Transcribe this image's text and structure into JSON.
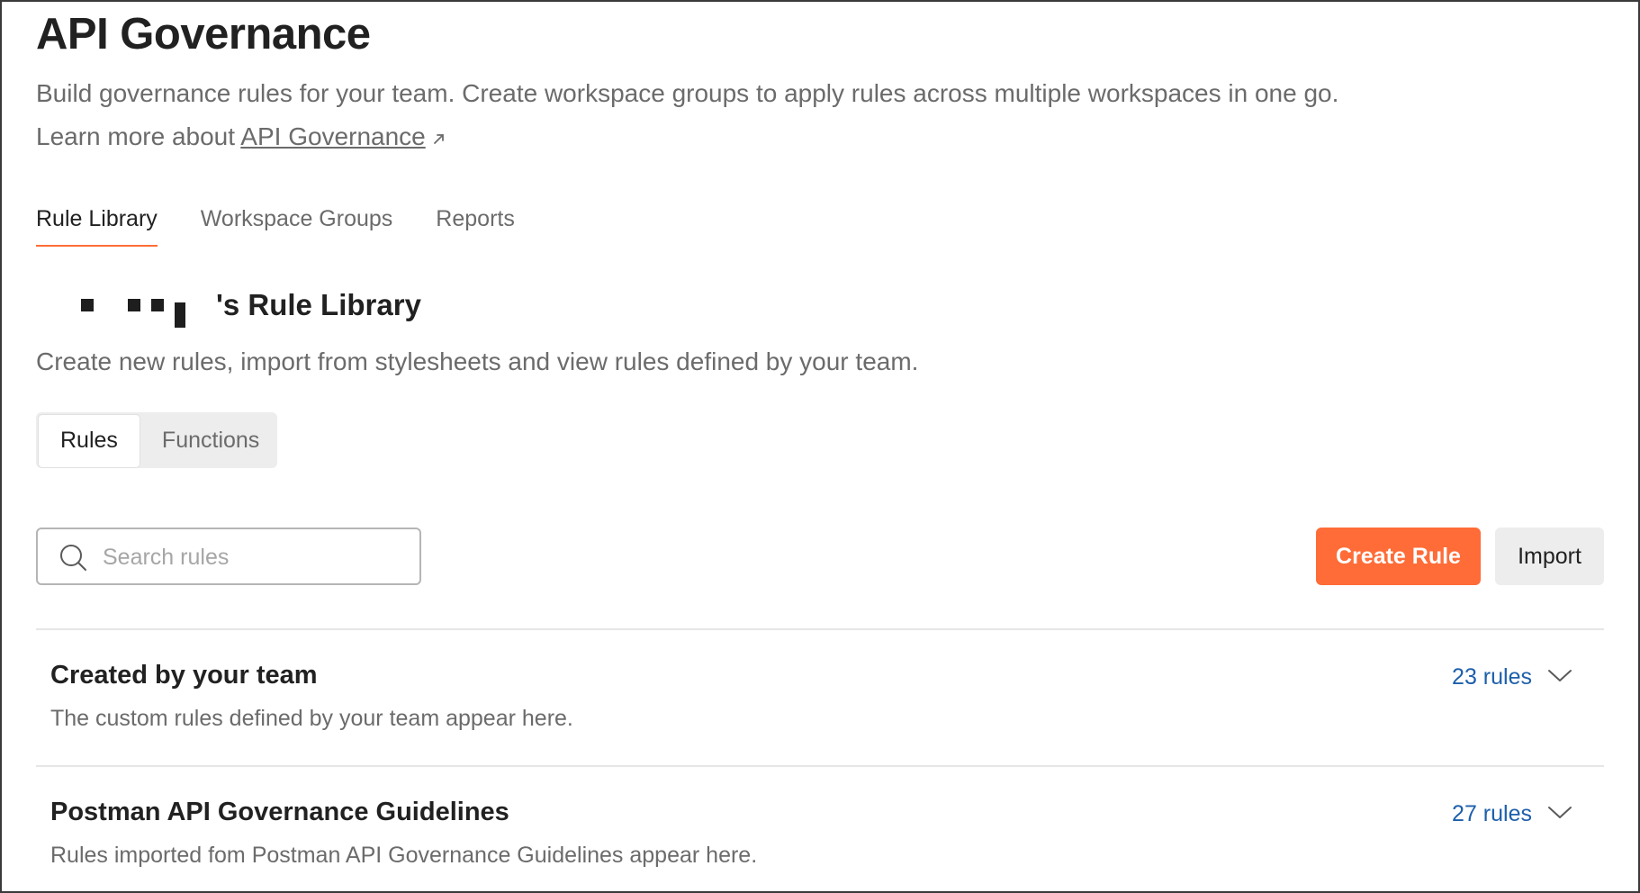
{
  "page": {
    "title": "API Governance",
    "description": "Build governance rules for your team. Create workspace groups to apply rules across multiple workspaces in one go.",
    "learn_more_prefix": "Learn more about ",
    "learn_more_link": "API Governance"
  },
  "tabs": [
    {
      "label": "Rule Library",
      "active": true
    },
    {
      "label": "Workspace Groups",
      "active": false
    },
    {
      "label": "Reports",
      "active": false
    }
  ],
  "library": {
    "title_suffix": "'s Rule Library",
    "description": "Create new rules, import from stylesheets and view rules defined by your team."
  },
  "segmented": {
    "items": [
      {
        "label": "Rules",
        "active": true
      },
      {
        "label": "Functions",
        "active": false
      }
    ]
  },
  "search": {
    "placeholder": "Search rules",
    "value": ""
  },
  "actions": {
    "create_label": "Create Rule",
    "import_label": "Import"
  },
  "sections": [
    {
      "title": "Created by your team",
      "description": "The custom rules defined by your team appear here.",
      "count": "23 rules"
    },
    {
      "title": "Postman API Governance Guidelines",
      "description": "Rules imported fom Postman API Governance Guidelines appear here.",
      "count": "27 rules"
    }
  ],
  "colors": {
    "accent": "#ff6c37",
    "link": "#1d5fab",
    "muted_text": "#6b6b6b"
  },
  "icons": [
    "external-link-icon",
    "search-icon",
    "chevron-down-icon"
  ]
}
